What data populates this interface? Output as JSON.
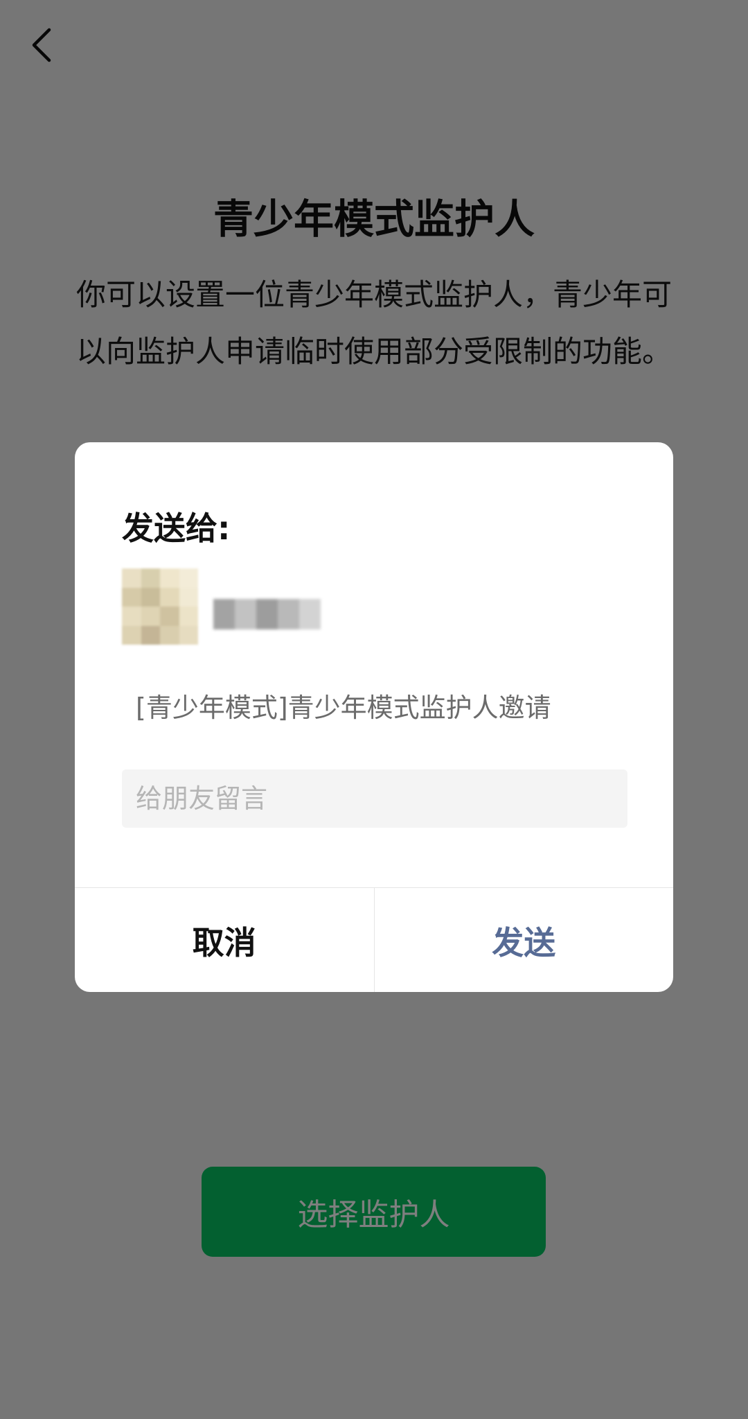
{
  "page": {
    "title": "青少年模式监护人",
    "description": "你可以设置一位青少年模式监护人，青少年可以向监护人申请临时使用部分受限制的功能。",
    "primary_button": "选择监护人",
    "back_icon": "chevron-left-icon"
  },
  "dialog": {
    "heading": "发送给:",
    "recipient": {
      "avatar_colors": [
        "#e9dfc4",
        "#d8cfae",
        "#efe6cc",
        "#f3ecd8",
        "#d6caa8",
        "#c9bd9a",
        "#e4d9b9",
        "#f1ead4",
        "#e7ddc0",
        "#dfd4b4",
        "#cfc2a0",
        "#ece3c8",
        "#ddd2b2",
        "#c4b596",
        "#d9ceae",
        "#e6dcc0"
      ],
      "name_colors": [
        "#a3a3a3",
        "#c2c2c2",
        "#9d9d9d",
        "#b9b9b9",
        "#d3d3d3"
      ]
    },
    "share_card_title": "[青少年模式]青少年模式监护人邀请",
    "message_placeholder": "给朋友留言",
    "message_value": "",
    "cancel_label": "取消",
    "send_label": "发送"
  },
  "colors": {
    "accent_green": "#07c160",
    "link_blue": "#576b95",
    "page_background": "#ededed"
  }
}
